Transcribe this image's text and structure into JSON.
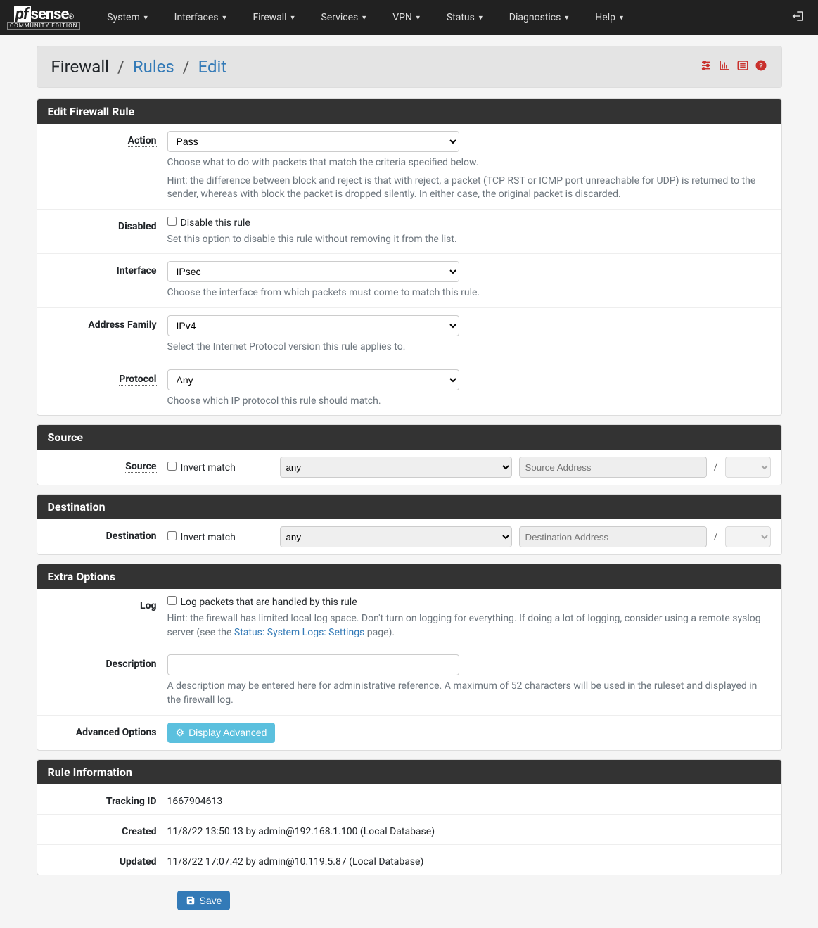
{
  "nav": {
    "items": [
      "System",
      "Interfaces",
      "Firewall",
      "Services",
      "VPN",
      "Status",
      "Diagnostics",
      "Help"
    ]
  },
  "breadcrumb": {
    "a": "Firewall",
    "b": "Rules",
    "c": "Edit"
  },
  "panels": {
    "edit": {
      "title": "Edit Firewall Rule",
      "action": {
        "label": "Action",
        "value": "Pass",
        "help1": "Choose what to do with packets that match the criteria specified below.",
        "help2": "Hint: the difference between block and reject is that with reject, a packet (TCP RST or ICMP port unreachable for UDP) is returned to the sender, whereas with block the packet is dropped silently. In either case, the original packet is discarded."
      },
      "disabled": {
        "label": "Disabled",
        "chk": "Disable this rule",
        "help": "Set this option to disable this rule without removing it from the list."
      },
      "interface": {
        "label": "Interface",
        "value": "IPsec",
        "help": "Choose the interface from which packets must come to match this rule."
      },
      "af": {
        "label": "Address Family",
        "value": "IPv4",
        "help": "Select the Internet Protocol version this rule applies to."
      },
      "proto": {
        "label": "Protocol",
        "value": "Any",
        "help": "Choose which IP protocol this rule should match."
      }
    },
    "source": {
      "title": "Source",
      "label": "Source",
      "invert": "Invert match",
      "type": "any",
      "addr_ph": "Source Address"
    },
    "dest": {
      "title": "Destination",
      "label": "Destination",
      "invert": "Invert match",
      "type": "any",
      "addr_ph": "Destination Address"
    },
    "extra": {
      "title": "Extra Options",
      "log": {
        "label": "Log",
        "chk": "Log packets that are handled by this rule",
        "help1": "Hint: the firewall has limited local log space. Don't turn on logging for everything. If doing a lot of logging, consider using a remote syslog server (see the ",
        "link": "Status: System Logs: Settings",
        "help2": " page)."
      },
      "desc": {
        "label": "Description",
        "help": "A description may be entered here for administrative reference. A maximum of 52 characters will be used in the ruleset and displayed in the firewall log."
      },
      "adv": {
        "label": "Advanced Options",
        "btn": "Display Advanced"
      }
    },
    "info": {
      "title": "Rule Information",
      "tracking": {
        "label": "Tracking ID",
        "value": "1667904613"
      },
      "created": {
        "label": "Created",
        "value": "11/8/22 13:50:13 by admin@192.168.1.100 (Local Database)"
      },
      "updated": {
        "label": "Updated",
        "value": "11/8/22 17:07:42 by admin@10.119.5.87 (Local Database)"
      }
    }
  },
  "save": "Save",
  "slash": "/"
}
